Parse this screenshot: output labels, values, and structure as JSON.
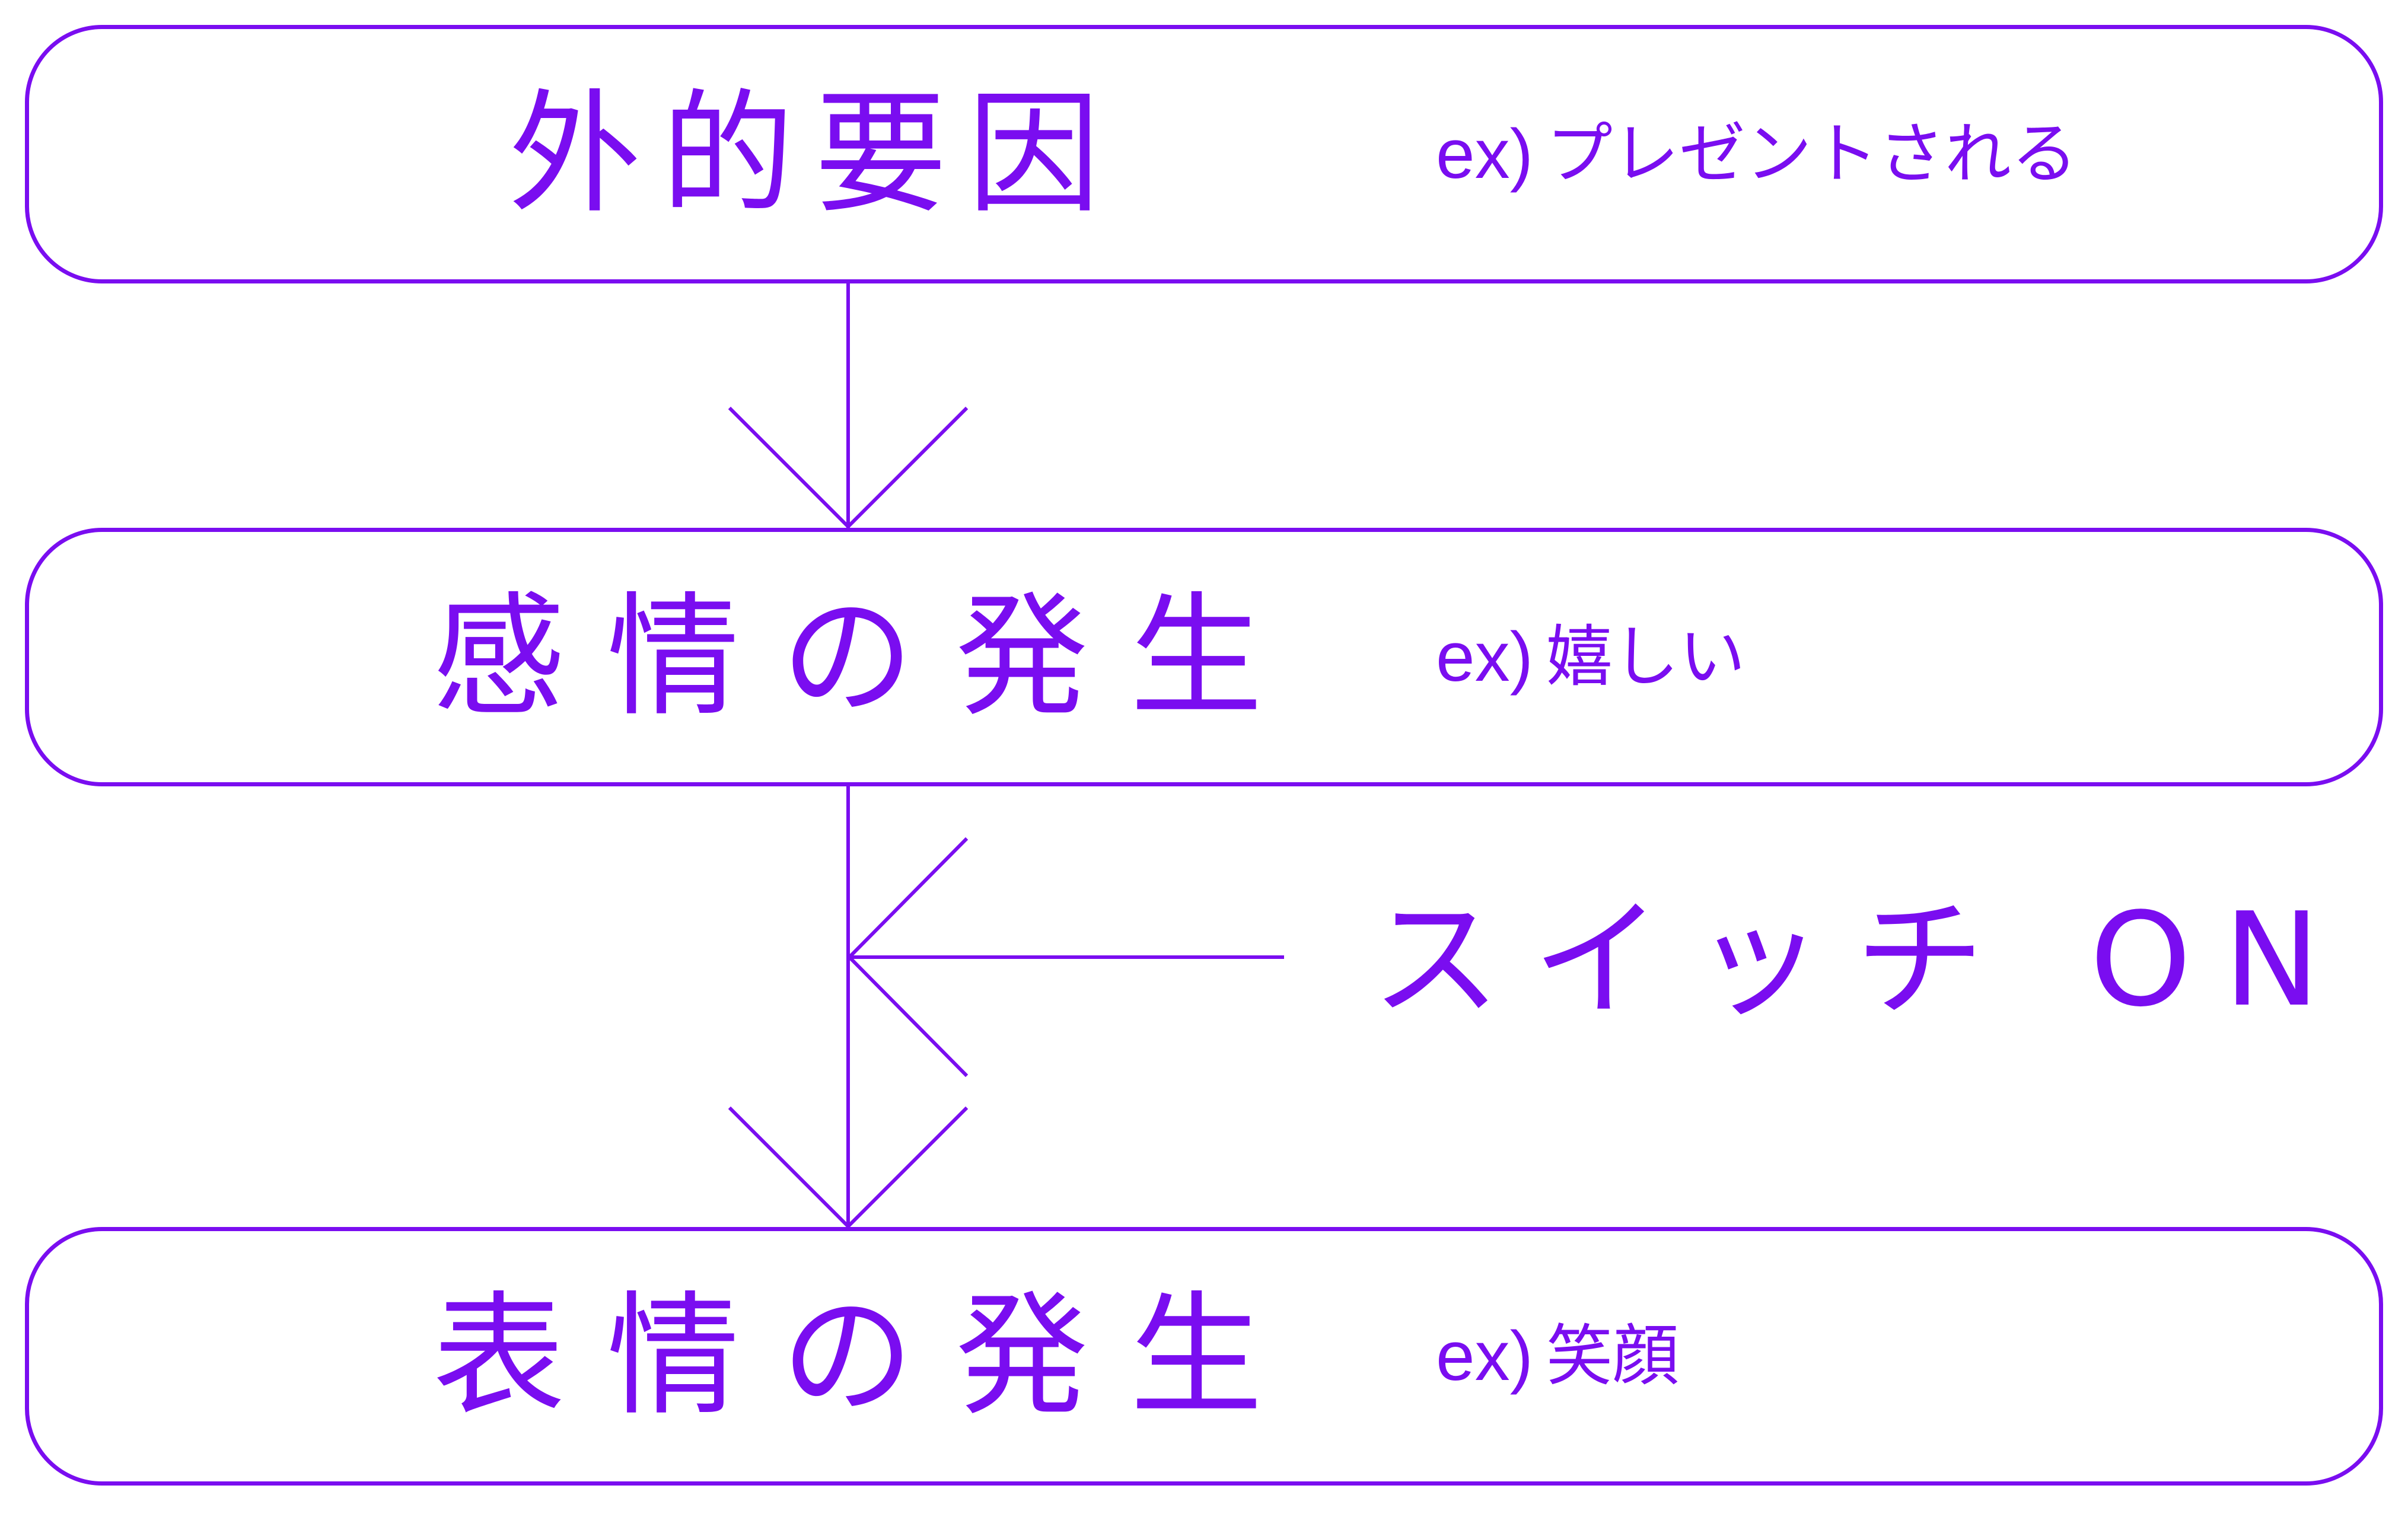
{
  "colors": {
    "accent": "#7a0df0",
    "background": "#ffffff"
  },
  "steps": [
    {
      "label": "外的要因",
      "example_prefix": "ex)",
      "example": "プレゼントされる"
    },
    {
      "label": "感情の発生",
      "example_prefix": "ex)",
      "example": "嬉しい"
    },
    {
      "label": "表情の発生",
      "example_prefix": "ex)",
      "example": "笑顔"
    }
  ],
  "switch": {
    "label": "スイッチ ON"
  }
}
